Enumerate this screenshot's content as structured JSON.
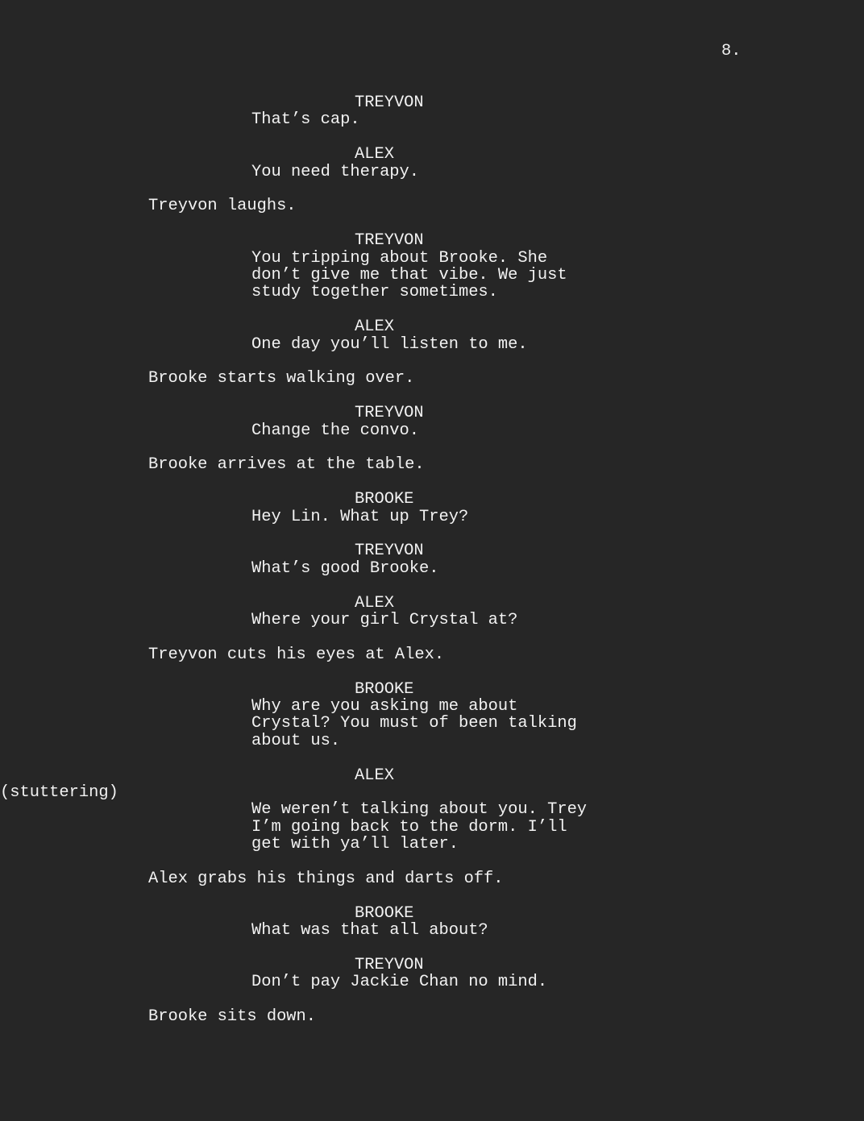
{
  "page_number": "8.",
  "blocks": [
    {
      "type": "character",
      "text": "TREYVON"
    },
    {
      "type": "dialogue",
      "lines": [
        "That’s cap."
      ]
    },
    {
      "type": "character",
      "text": "ALEX"
    },
    {
      "type": "dialogue",
      "lines": [
        "You need therapy."
      ]
    },
    {
      "type": "action",
      "lines": [
        "Treyvon laughs."
      ]
    },
    {
      "type": "character",
      "text": "TREYVON"
    },
    {
      "type": "dialogue",
      "lines": [
        "You tripping about Brooke. She",
        "don’t give me that vibe. We just",
        "study together sometimes."
      ]
    },
    {
      "type": "character",
      "text": "ALEX"
    },
    {
      "type": "dialogue",
      "lines": [
        "One day you’ll listen to me."
      ]
    },
    {
      "type": "action",
      "lines": [
        "Brooke starts walking over."
      ]
    },
    {
      "type": "character",
      "text": "TREYVON"
    },
    {
      "type": "dialogue",
      "lines": [
        "Change the convo."
      ]
    },
    {
      "type": "action",
      "lines": [
        "Brooke arrives at the table."
      ]
    },
    {
      "type": "character",
      "text": "BROOKE"
    },
    {
      "type": "dialogue",
      "lines": [
        "Hey Lin. What up Trey?"
      ]
    },
    {
      "type": "character",
      "text": "TREYVON"
    },
    {
      "type": "dialogue",
      "lines": [
        "What’s good Brooke."
      ]
    },
    {
      "type": "character",
      "text": "ALEX"
    },
    {
      "type": "dialogue",
      "lines": [
        "Where your girl Crystal at?"
      ]
    },
    {
      "type": "action",
      "lines": [
        "Treyvon cuts his eyes at Alex."
      ]
    },
    {
      "type": "character",
      "text": "BROOKE"
    },
    {
      "type": "dialogue",
      "lines": [
        "Why are you asking me about",
        "Crystal? You must of been talking",
        "about us."
      ]
    },
    {
      "type": "character",
      "text": "ALEX"
    },
    {
      "type": "parenthetical",
      "text": "(stuttering)"
    },
    {
      "type": "dialogue",
      "lines": [
        "We weren’t talking about you. Trey",
        "I’m going back to the dorm. I’ll",
        "get with ya’ll later."
      ]
    },
    {
      "type": "action",
      "lines": [
        "Alex grabs his things and darts off."
      ]
    },
    {
      "type": "character",
      "text": "BROOKE"
    },
    {
      "type": "dialogue",
      "lines": [
        "What was that all about?"
      ]
    },
    {
      "type": "character",
      "text": "TREYVON"
    },
    {
      "type": "dialogue",
      "lines": [
        "Don’t pay Jackie Chan no mind."
      ]
    },
    {
      "type": "action",
      "lines": [
        "Brooke sits down."
      ]
    }
  ]
}
